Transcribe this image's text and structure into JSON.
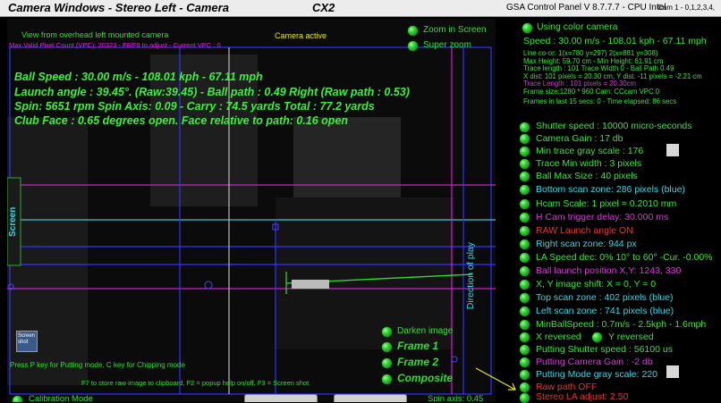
{
  "titlebar": {
    "left": "Camera Windows - Stereo Left - Camera",
    "mid": "CX2",
    "right": "GSA Control Panel V 8.7.7.7 - CPU Intel",
    "cam": "Cam 1 - 0,1,2,3,4,"
  },
  "camera": {
    "view_label": "View from overhead left mounted camera",
    "vpc_line": "Max Valid Pixel Count (VPC): 20323 - F8/F9 to adjust - Current VPC : 0",
    "active": "Camera active",
    "zoom_in": "Zoom in Screen",
    "super_zoom": "Super zoom",
    "screen_label": "Screen",
    "direction_label": "Direction of play",
    "overlay": {
      "line1": "Ball Speed : 30.00 m/s - 108.01 kph - 67.11 mph",
      "line2": "Launch angle : 39.45°. (Raw:39.45) - Ball path : 0.49 Right (Raw path : 0.53)",
      "line3": "Spin: 5651 rpm  Spin Axis: 0.09 - Carry : 74.5 yards  Total : 77.2 yards",
      "line4": "Club Face : 0.65 degrees open.    Face relative to path: 0.16 open"
    },
    "screenshot_icon_label": "Screen shot",
    "darken": "Darken image",
    "frame1": "Frame 1",
    "frame2": "Frame 2",
    "composite": "Composite",
    "help_line": "Press P key for Putting mode, C key for Chipping mode",
    "f7_line": "F7 to store raw image to clipboard, F2 = popup help on/off, F3 = Screen shot",
    "calibration": "Calibration Mode",
    "spin_axis": "Spin axis: 0.45"
  },
  "panel": {
    "using_color": "Using color camera",
    "speed": "Speed : 30.00 m/s - 108.01 kph - 67.11 mph",
    "info": [
      "Line co-or: 1(x=780 y=297) 2(x=881 y=308)",
      "Max Height: 59.70 cm - Min Height: 61.91 cm",
      "Trace length : 101 Trace Width 0 - Ball Path 0.49",
      "X dist: 101 pixels = 20.30 cm, Y dist. -11 pixels = -2.21 cm",
      "Trace Length : 101 pixels = 20.30cm",
      "Frame size:1280 * 960 Cam: CCcam VPC:0",
      "Frames in last 15 secs: 0 - Time elapsed:  86 secs"
    ],
    "items": [
      {
        "label": "Shutter speed : 10000 micro-seconds",
        "color": "g"
      },
      {
        "label": "Camera Gain : 17 db",
        "color": "g"
      },
      {
        "label": "Min trace gray scale : 176",
        "color": "g"
      },
      {
        "label": "Trace Min width : 3 pixels",
        "color": "g"
      },
      {
        "label": "Ball Max Size : 40 pixels",
        "color": "g"
      },
      {
        "label": "Bottom scan zone: 286 pixels (blue)",
        "color": "c"
      },
      {
        "label": "Hcam Scale: 1 pixel = 0.2010 mm",
        "color": "g"
      },
      {
        "label": "H Cam trigger delay: 30.000 ms",
        "color": "m"
      },
      {
        "label": "RAW Launch angle ON",
        "color": "r"
      },
      {
        "label": "Right scan zone: 944 px",
        "color": "c"
      },
      {
        "label": "LA Speed dec: 0% 10° to 60° -Cur. -0.00%",
        "color": "g"
      },
      {
        "label": "Ball launch position X,Y: 1243, 330",
        "color": "m"
      },
      {
        "label": "X, Y image shift: X = 0, Y = 0",
        "color": "g"
      },
      {
        "label": "Top scan zone : 402 pixels (blue)",
        "color": "c"
      },
      {
        "label": "Left scan zone : 741 pixels (blue)",
        "color": "c"
      },
      {
        "label": "MinBallSpeed : 0.7m/s - 2.5kph - 1.6mph",
        "color": "g"
      },
      {
        "label": "X reversed",
        "color": "g"
      },
      {
        "label": "Putting Shutter speed : 56100 us",
        "color": "g"
      },
      {
        "label": "Putting Camera Gain : -2 db",
        "color": "m"
      },
      {
        "label": "Putting Mode gray scale: 220",
        "color": "c"
      },
      {
        "label": "Raw path OFF",
        "color": "r"
      },
      {
        "label": "Stereo LA adjust: 2.50",
        "color": "r"
      }
    ],
    "y_reversed": "Y reversed"
  }
}
